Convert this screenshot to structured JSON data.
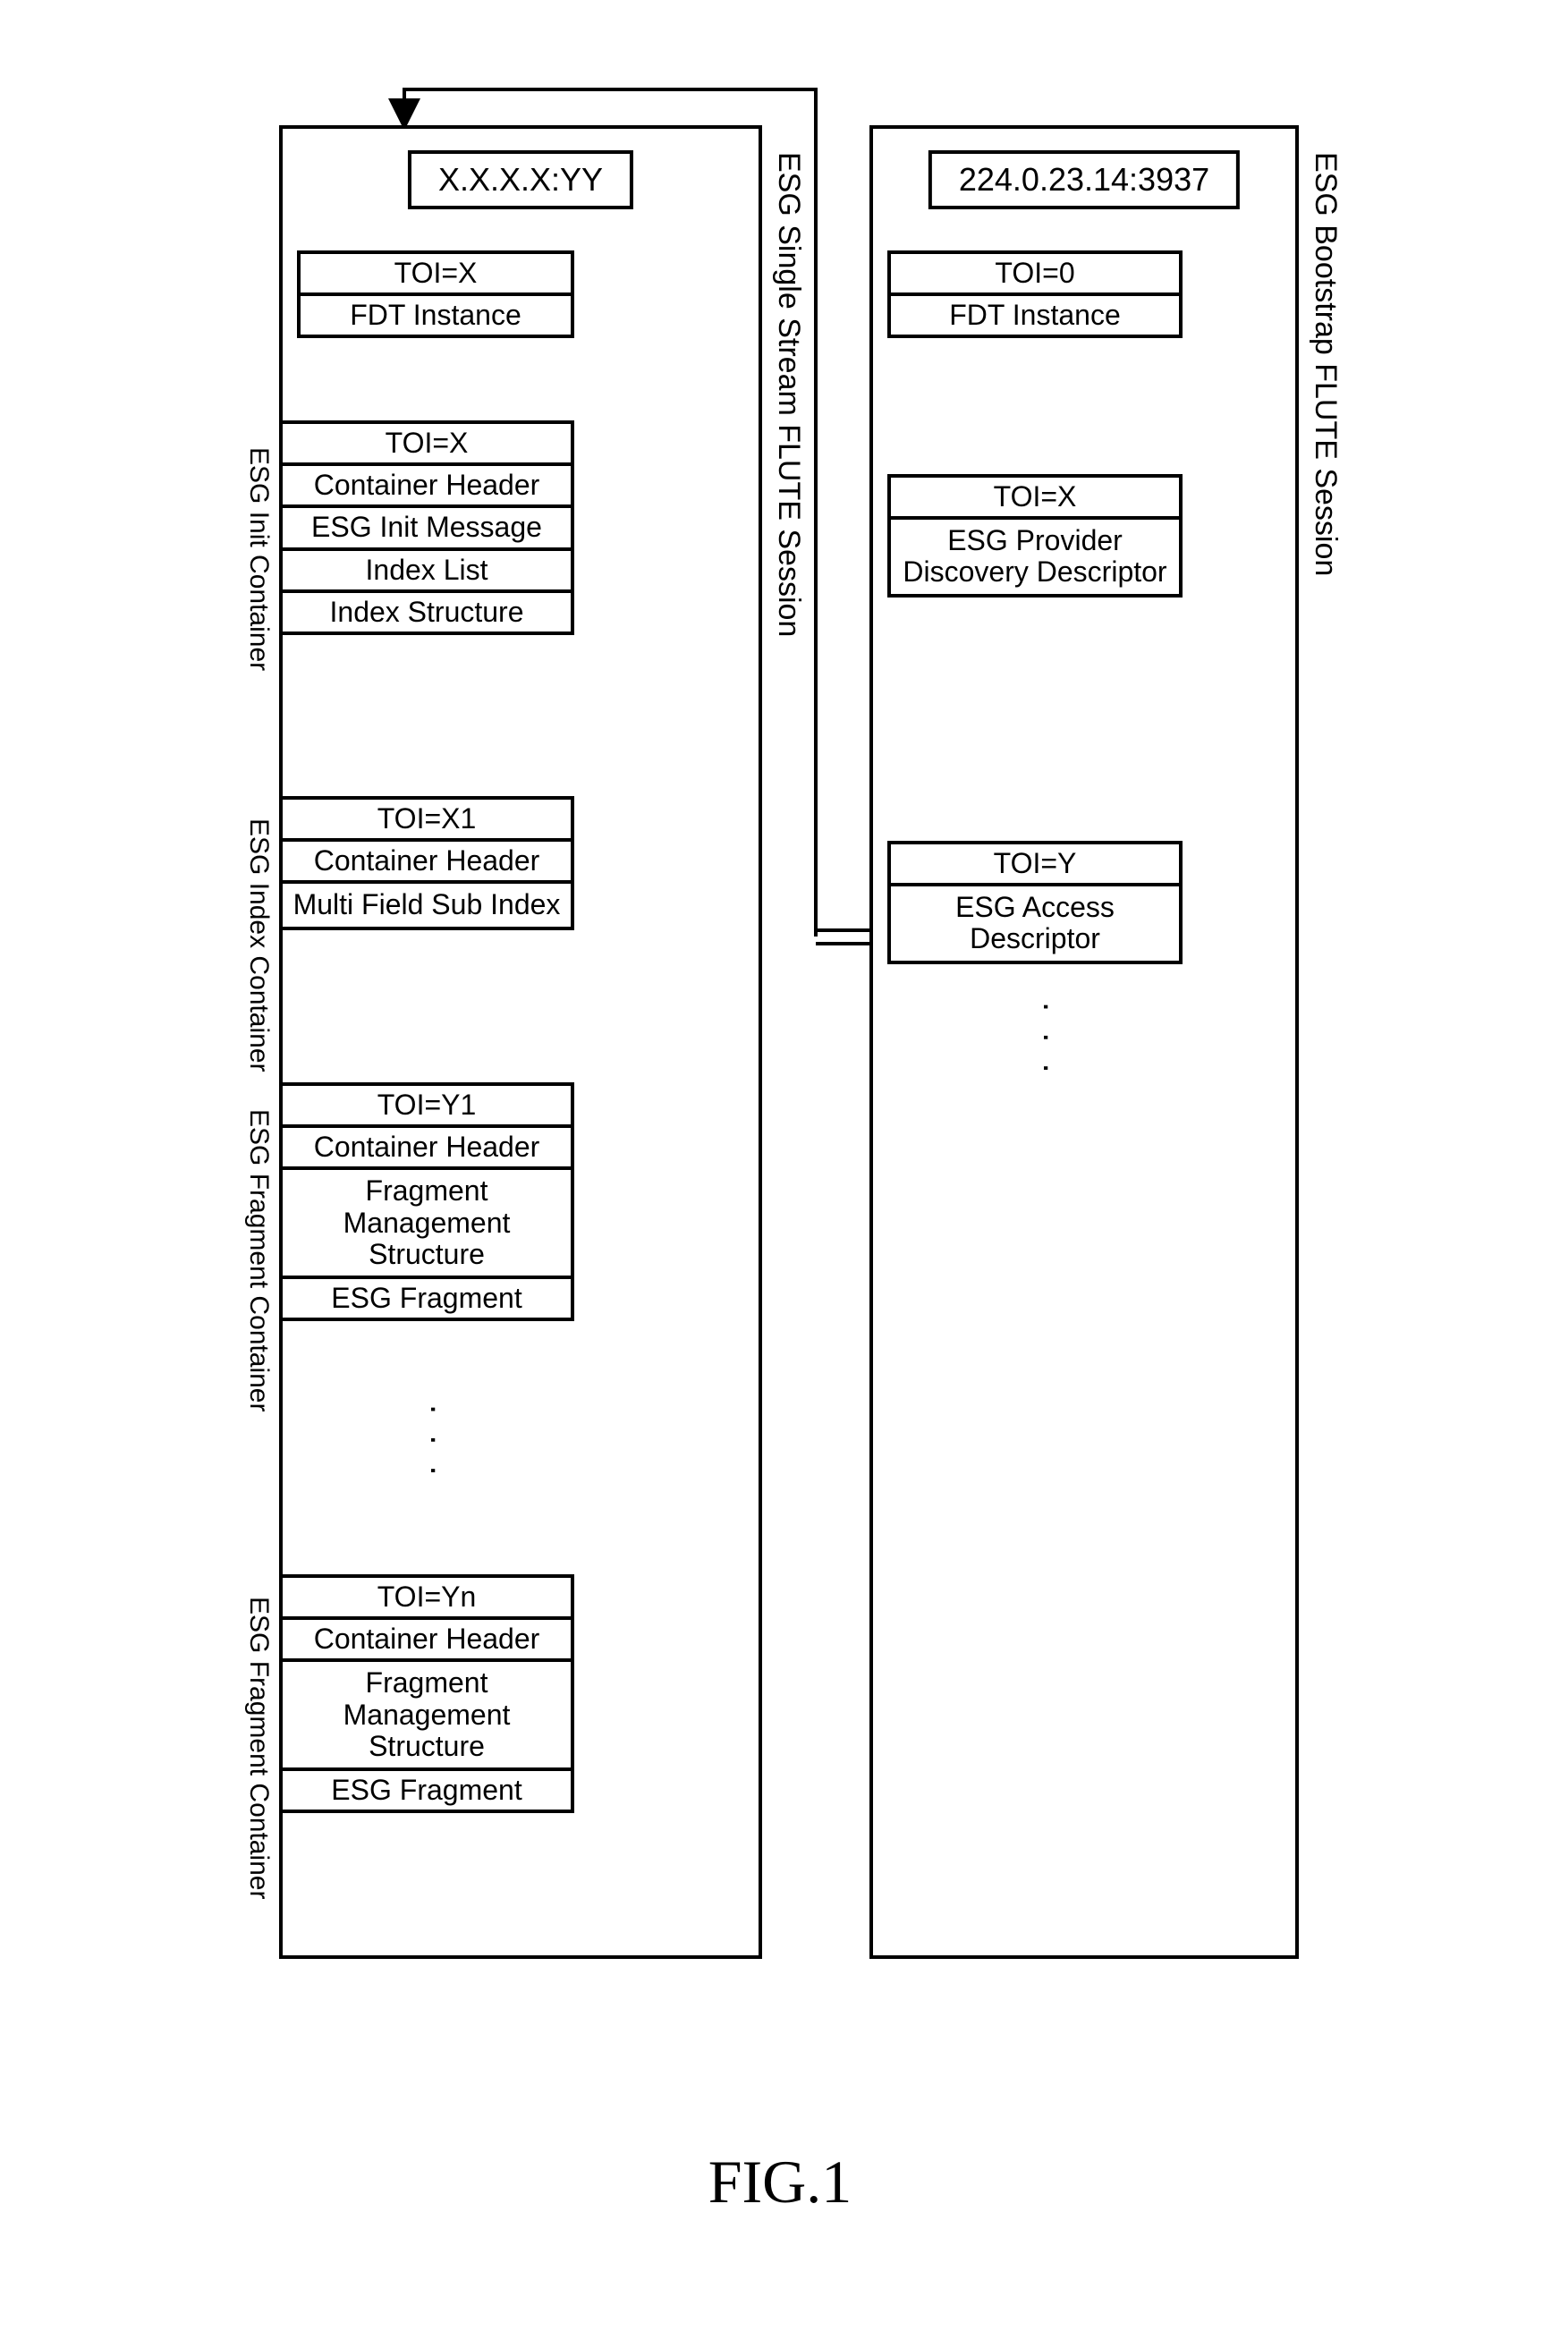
{
  "figure_caption": "FIG.1",
  "left_session_label": "ESG Single Stream FLUTE Session",
  "right_session_label": "ESG Bootstrap FLUTE Session",
  "left_addr": "X.X.X.X:YY",
  "right_addr": "224.0.23.14:3937",
  "right": {
    "fdt": {
      "toi": "TOI=0",
      "body": "FDT Instance"
    },
    "pd": {
      "toi": "TOI=X",
      "body": "ESG Provider Discovery Descriptor"
    },
    "ad": {
      "toi": "TOI=Y",
      "body": "ESG Access Descriptor"
    }
  },
  "left": {
    "fdt": {
      "toi": "TOI=X",
      "body": "FDT Instance"
    },
    "init": {
      "label": "ESG Init Container",
      "toi": "TOI=X",
      "r1": "Container Header",
      "r2": "ESG Init Message",
      "r3": "Index List",
      "r4": "Index Structure"
    },
    "index": {
      "label": "ESG Index Container",
      "toi": "TOI=X1",
      "r1": "Container Header",
      "r2": "Multi Field Sub Index"
    },
    "frag1": {
      "label": "ESG Fragment Container",
      "toi": "TOI=Y1",
      "r1": "Container Header",
      "r2": "Fragment Management Structure",
      "r3": "ESG Fragment"
    },
    "fragn": {
      "label": "ESG Fragment Container",
      "toi": "TOI=Yn",
      "r1": "Container Header",
      "r2": "Fragment Management Structure",
      "r3": "ESG Fragment"
    }
  },
  "ellipsis": ". . ."
}
